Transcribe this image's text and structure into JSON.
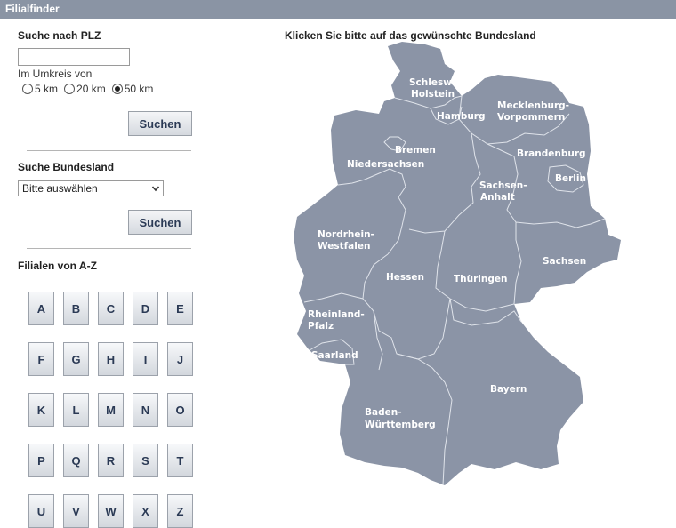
{
  "window": {
    "title": "Filialfinder"
  },
  "plz_search": {
    "heading": "Suche nach PLZ",
    "input_value": "",
    "radius_label": "Im Umkreis von",
    "radius_options": [
      "5 km",
      "20 km",
      "50 km"
    ],
    "selected_radius": "50 km",
    "button_label": "Suchen"
  },
  "state_search": {
    "heading": "Suche Bundesland",
    "select_value": "Bitte auswählen",
    "button_label": "Suchen"
  },
  "az": {
    "heading": "Filialen von A-Z",
    "letters": [
      "A",
      "B",
      "C",
      "D",
      "E",
      "F",
      "G",
      "H",
      "I",
      "J",
      "K",
      "L",
      "M",
      "N",
      "O",
      "P",
      "Q",
      "R",
      "S",
      "T",
      "U",
      "V",
      "W",
      "X",
      "Z"
    ]
  },
  "map": {
    "heading": "Klicken Sie bitte auf das gewünschte Bundesland",
    "states": {
      "schleswig_holstein": [
        "Schleswig-",
        "Holstein"
      ],
      "hamburg": "Hamburg",
      "mecklenburg_vorpommern": [
        "Mecklenburg-",
        "Vorpommern"
      ],
      "bremen": "Bremen",
      "niedersachsen": "Niedersachsen",
      "brandenburg": "Brandenburg",
      "berlin": "Berlin",
      "sachsen_anhalt": [
        "Sachsen-",
        "Anhalt"
      ],
      "nordrhein_westfalen": [
        "Nordrhein-",
        "Westfalen"
      ],
      "hessen": "Hessen",
      "thueringen": "Thüringen",
      "sachsen": "Sachsen",
      "rheinland_pfalz": [
        "Rheinland-",
        "Pfalz"
      ],
      "saarland": "Saarland",
      "bayern": "Bayern",
      "baden_wuerttemberg": [
        "Baden-",
        "Württemberg"
      ]
    }
  }
}
